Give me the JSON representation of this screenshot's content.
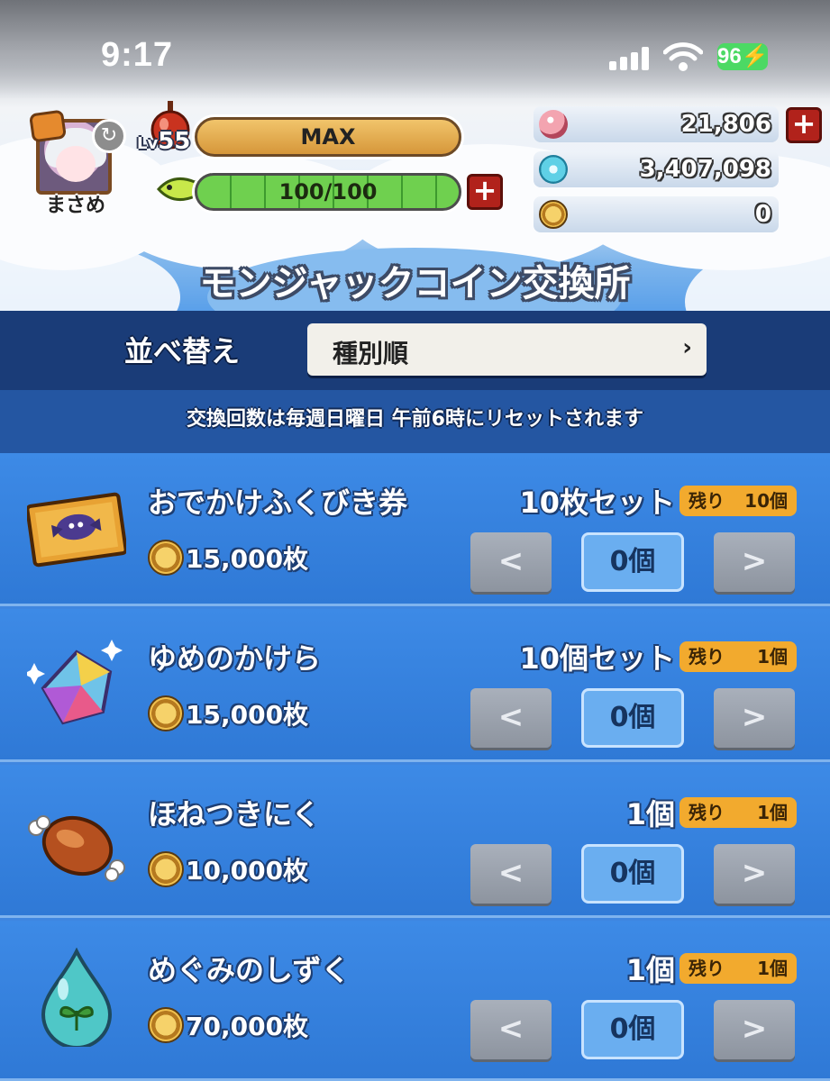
{
  "status_bar": {
    "time": "9:17",
    "battery": "96"
  },
  "player": {
    "name": "まさめ",
    "level_prefix": "Lv",
    "level": "55",
    "exp_text": "MAX",
    "stamina_text": "100/100"
  },
  "currencies": [
    {
      "icon": "gem-icon",
      "value": "21,806"
    },
    {
      "icon": "crystal-icon",
      "value": "3,407,098"
    },
    {
      "icon": "monjack-coin-icon",
      "value": "0"
    }
  ],
  "shop": {
    "title": "モンジャックコイン交換所",
    "sort_label": "並べ替え",
    "sort_value": "種別順",
    "notice": "交換回数は毎週日曜日 午前6時にリセットされます"
  },
  "items": [
    {
      "name": "おでかけふくびき券",
      "set": "10枚セット",
      "remain_label": "残り",
      "remain_value": "10個",
      "price": "15,000枚",
      "qty": "0個",
      "icon": "lottery-ticket-icon"
    },
    {
      "name": "ゆめのかけら",
      "set": "10個セット",
      "remain_label": "残り",
      "remain_value": "1個",
      "price": "15,000枚",
      "qty": "0個",
      "icon": "rainbow-crystal-icon"
    },
    {
      "name": "ほねつきにく",
      "set": "1個",
      "remain_label": "残り",
      "remain_value": "1個",
      "price": "10,000枚",
      "qty": "0個",
      "icon": "meat-icon"
    },
    {
      "name": "めぐみのしずく",
      "set": "1個",
      "remain_label": "残り",
      "remain_value": "1個",
      "price": "70,000枚",
      "qty": "0個",
      "icon": "water-drop-icon"
    }
  ],
  "stepper": {
    "prev": "<",
    "next": ">"
  }
}
